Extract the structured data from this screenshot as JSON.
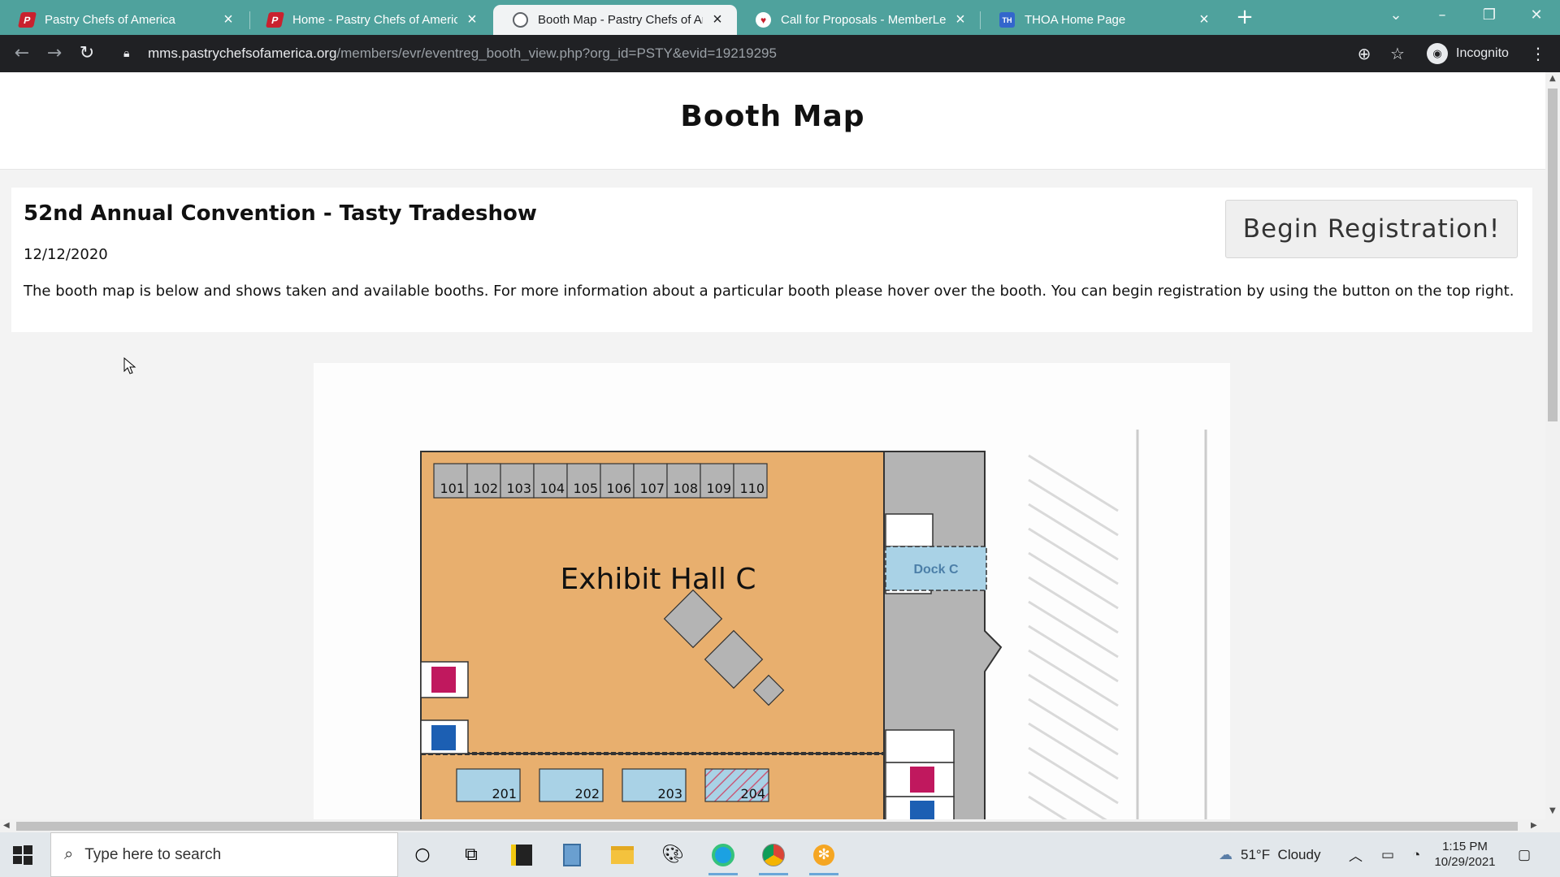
{
  "browser": {
    "tabs": [
      {
        "title": "Pastry Chefs of America",
        "favicon": "pastry-chefs-logo-icon",
        "active": false
      },
      {
        "title": "Home - Pastry Chefs of America",
        "favicon": "pastry-chefs-logo-icon",
        "active": false
      },
      {
        "title": "Booth Map - Pastry Chefs of Am",
        "favicon": "globe-icon",
        "active": true
      },
      {
        "title": "Call for Proposals - MemberLeap",
        "favicon": "memberleap-icon",
        "active": false
      },
      {
        "title": "THOA Home Page",
        "favicon": "thoa-icon",
        "active": false
      }
    ],
    "url_host": "mms.pastrychefsofamerica.org",
    "url_path": "/members/evr/eventreg_booth_view.php?org_id=PSTY&evid=19219295",
    "profile_label": "Incognito"
  },
  "page": {
    "title": "Booth Map",
    "event_title": "52nd Annual Convention - Tasty Tradeshow",
    "event_date": "12/12/2020",
    "description": "The booth map is below and shows taken and available booths. For more information about a particular booth please hover over the booth. You can begin registration by using the button on the top right.",
    "register_button": "Begin Registration!"
  },
  "map": {
    "hall_label": "Exhibit Hall C",
    "dock_label": "Dock C",
    "booths_row1": [
      "101",
      "102",
      "103",
      "104",
      "105",
      "106",
      "107",
      "108",
      "109",
      "110"
    ],
    "booths_row2": [
      {
        "number": "201",
        "status": "available"
      },
      {
        "number": "202",
        "status": "available"
      },
      {
        "number": "203",
        "status": "available"
      },
      {
        "number": "204",
        "status": "taken"
      }
    ],
    "colors": {
      "hall": "#e8af6e",
      "booth_available": "#a9d2e6",
      "booth_taken_hatch": "#c85b7a",
      "restroom_women": "#c0185e",
      "restroom_men": "#1c5fb3",
      "service": "#b4b4b4"
    }
  },
  "taskbar": {
    "search_placeholder": "Type here to search",
    "weather": "51°F  Cloudy",
    "time": "1:15 PM",
    "date": "10/29/2021"
  }
}
